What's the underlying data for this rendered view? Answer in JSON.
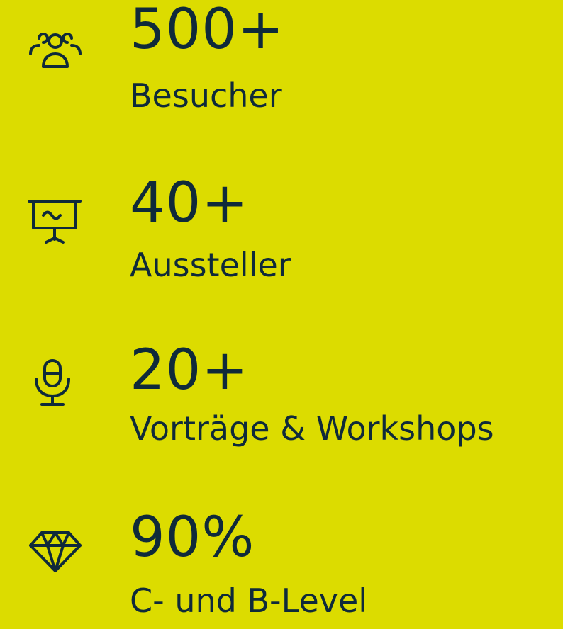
{
  "stats": [
    {
      "icon": "users-group-icon",
      "value": "500+",
      "label": "Besucher"
    },
    {
      "icon": "presentation-board-icon",
      "value": "40+",
      "label": "Aussteller"
    },
    {
      "icon": "microphone-icon",
      "value": "20+",
      "label": "Vorträge & Workshops"
    },
    {
      "icon": "diamond-icon",
      "value": "90%",
      "label": "C- und B-Level"
    }
  ],
  "colors": {
    "background": "#dcdc00",
    "foreground": "#0f2a3a"
  }
}
